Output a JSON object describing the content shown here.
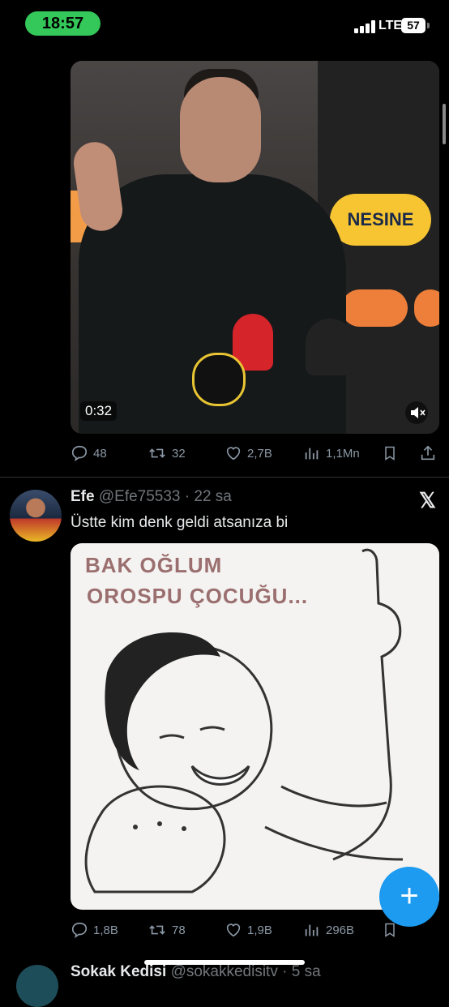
{
  "status_bar": {
    "time": "18:57",
    "network": "LTE",
    "battery": "57"
  },
  "tweet1": {
    "video": {
      "duration": "0:32",
      "sponsor": "NESINE"
    },
    "actions": {
      "replies": "48",
      "retweets": "32",
      "likes": "2,7B",
      "views": "1,1Mn"
    }
  },
  "tweet2": {
    "name": "Efe",
    "handle": "@Efe75533",
    "time": "· 22 sa",
    "text": "Üstte kim denk geldi atsanıza bi",
    "image_text": {
      "line1": "BAK OĞLUM",
      "line2": "OROSPU ÇOCUĞU..."
    },
    "actions": {
      "replies": "1,8B",
      "retweets": "78",
      "likes": "1,9B",
      "views": "296B"
    }
  },
  "next_tweet": {
    "name": "Sokak Kedisi",
    "handle": "@sokakkedisitv · 5 sa"
  },
  "fab": {
    "label": "+"
  },
  "colors": {
    "accent": "#1d9bf0",
    "status_pill": "#34c759",
    "muted": "#8b98a5"
  },
  "icons": [
    "reply-icon",
    "retweet-icon",
    "like-icon",
    "views-icon",
    "bookmark-icon",
    "share-icon",
    "x-logo-icon",
    "mute-icon",
    "compose-icon"
  ]
}
